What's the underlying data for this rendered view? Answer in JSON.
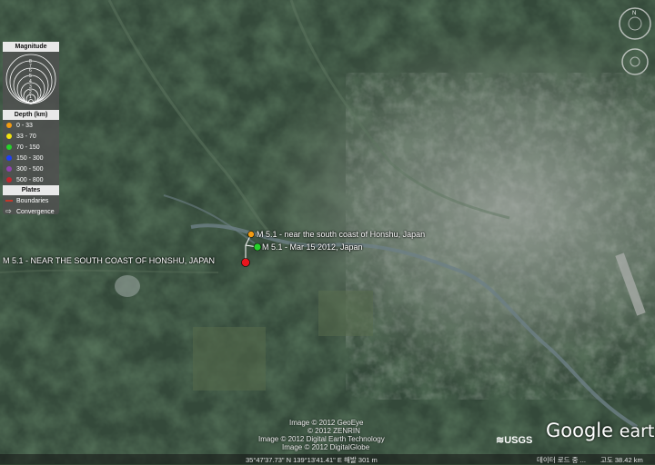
{
  "legend": {
    "magnitude_title": "Magnitude",
    "magnitude_scale": [
      "8",
      "7",
      "6",
      "5",
      "4",
      "3",
      "2",
      "1"
    ],
    "depth_title": "Depth (km)",
    "depth": [
      {
        "label": "0 - 33",
        "color": "#f39c12"
      },
      {
        "label": "33 - 70",
        "color": "#f1e40f"
      },
      {
        "label": "70 - 150",
        "color": "#27d22b"
      },
      {
        "label": "150 - 300",
        "color": "#1f3ff2"
      },
      {
        "label": "300 - 500",
        "color": "#8e44ad"
      },
      {
        "label": "500 - 800",
        "color": "#c0272d"
      }
    ],
    "plates_title": "Plates",
    "boundaries_label": "Boundaries",
    "convergence_label": "Convergence"
  },
  "quakes": [
    {
      "label": "M 5.1 - near the south coast of Honshu, Japan",
      "color": "#f39c12"
    },
    {
      "label": "M 5.1 - Mar 15 2012, Japan",
      "color": "#27d22b"
    },
    {
      "label": "M 5.1 - NEAR THE SOUTH COAST OF HONSHU, JAPAN",
      "color": "#e8161d"
    }
  ],
  "credits": [
    "Image © 2012 GeoEye",
    "© 2012 ZENRIN",
    "Image © 2012 Digital Earth Technology",
    "Image © 2012 DigitalGlobe"
  ],
  "brand": {
    "usgs": "≋USGS",
    "google": "Google",
    "earth": "earth"
  },
  "status": {
    "coords": "35°47'37.73\" N  139°13'41.41\" E  해발  301 m",
    "center": "데이터 로드 중 ...",
    "eye_alt": "고도  38.42 km"
  }
}
